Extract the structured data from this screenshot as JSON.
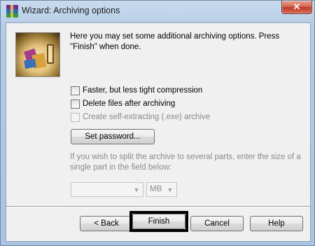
{
  "window": {
    "title": "Wizard:  Archiving options",
    "close_glyph": "✕"
  },
  "intro": "Here you may set some additional archiving options. Press \"Finish\" when done.",
  "options": {
    "faster": "Faster, but less tight compression",
    "delete": "Delete files after archiving",
    "sfx": "Create self-extracting (.exe) archive"
  },
  "set_password_label": "Set password...",
  "split": {
    "text": "If you wish to split the archive to several parts, enter the size of a single part in the field below:",
    "size_value": "",
    "unit_value": "MB"
  },
  "buttons": {
    "back": "< Back",
    "finish": "Finish",
    "cancel": "Cancel",
    "help": "Help"
  }
}
